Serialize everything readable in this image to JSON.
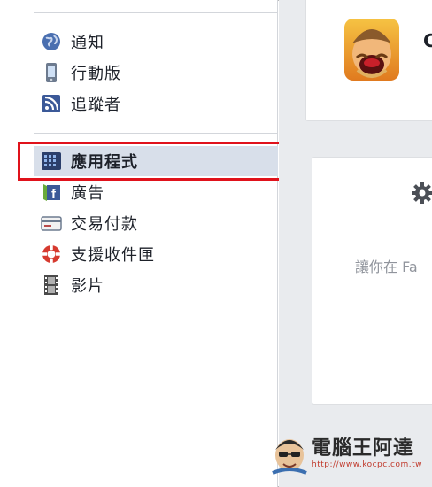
{
  "sidebar": {
    "items": [
      {
        "label": "通知",
        "icon": "globe-icon"
      },
      {
        "label": "行動版",
        "icon": "mobile-phone-icon"
      },
      {
        "label": "追蹤者",
        "icon": "rss-feed-icon"
      },
      {
        "label": "應用程式",
        "icon": "apps-grid-icon",
        "selected": true
      },
      {
        "label": "廣告",
        "icon": "facebook-ad-icon"
      },
      {
        "label": "交易付款",
        "icon": "credit-card-icon"
      },
      {
        "label": "支援收件匣",
        "icon": "lifebuoy-icon"
      },
      {
        "label": "影片",
        "icon": "film-strip-icon"
      }
    ]
  },
  "main": {
    "app_title_initial": "C",
    "invite_text": "讓你在 Fa"
  },
  "watermark": {
    "title": "電腦王阿達",
    "url": "http://www.kocpc.com.tw"
  },
  "colors": {
    "highlight": "#e0121b",
    "selected_bg": "#d8dfea",
    "main_bg": "#e9ebee"
  }
}
